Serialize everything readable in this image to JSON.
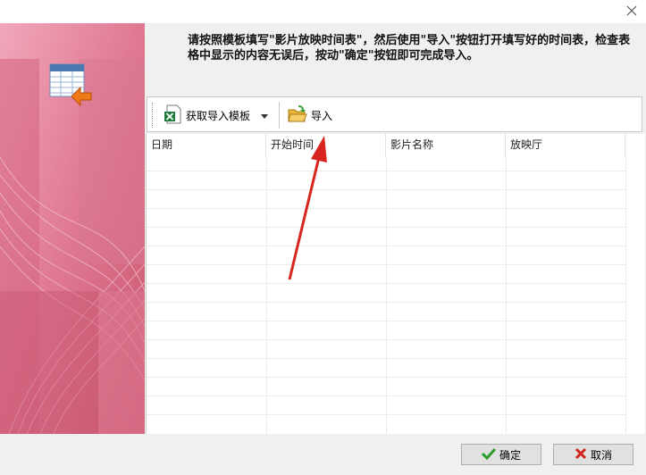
{
  "dialog": {
    "close_icon": "close-icon",
    "instructions": "请按照模板填写\"影片放映时间表\"，然后使用\"导入\"按钮打开填写好的时间表，检查表格中显示的内容无误后，按动\"确定\"按钮即可完成导入。"
  },
  "toolbar": {
    "template_label": "获取导入模板",
    "import_label": "导入"
  },
  "table": {
    "columns": [
      "日期",
      "开始时间",
      "影片名称",
      "放映厅"
    ]
  },
  "footer": {
    "ok_label": "确定",
    "cancel_label": "取消"
  },
  "colors": {
    "banner": "#e07b95",
    "arrow": "#d8261f"
  }
}
